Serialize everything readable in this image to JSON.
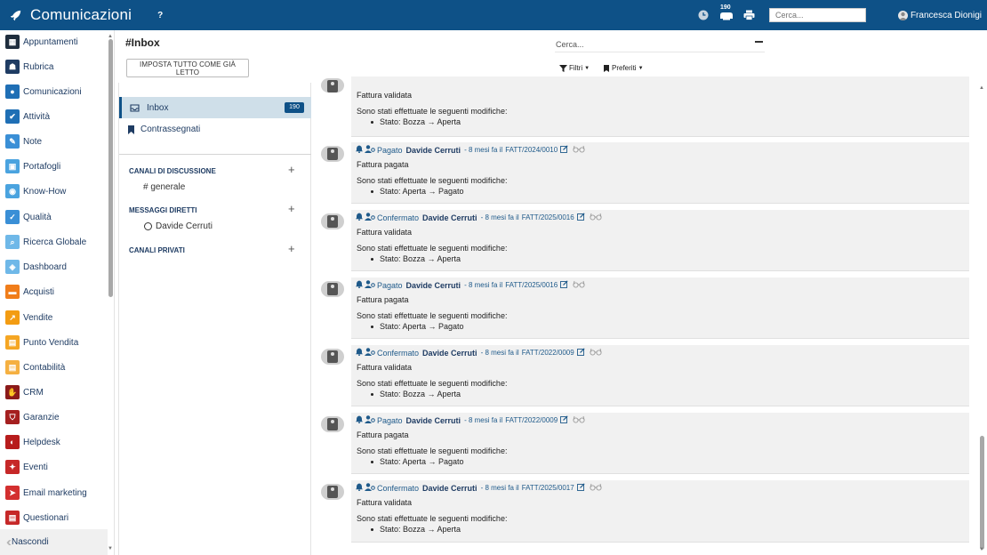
{
  "topbar": {
    "title": "Comunicazioni",
    "help": "?",
    "notif_count": "190",
    "search_placeholder": "Cerca...",
    "user_name": "Francesca Dionigi"
  },
  "sidebar": {
    "items": [
      {
        "label": "Appuntamenti",
        "icon": "calendar-icon",
        "color": "#1f2d3d"
      },
      {
        "label": "Rubrica",
        "icon": "contacts-icon",
        "color": "#1f3c63"
      },
      {
        "label": "Comunicazioni",
        "icon": "chat-icon",
        "color": "#1f6fb5"
      },
      {
        "label": "Attività",
        "icon": "check-icon",
        "color": "#1f6fb5"
      },
      {
        "label": "Note",
        "icon": "note-icon",
        "color": "#3a8fd6"
      },
      {
        "label": "Portafogli",
        "icon": "lock-icon",
        "color": "#4aa3df"
      },
      {
        "label": "Know-How",
        "icon": "brain-icon",
        "color": "#4aa3df"
      },
      {
        "label": "Qualità",
        "icon": "quality-icon",
        "color": "#3a8fd6"
      },
      {
        "label": "Ricerca Globale",
        "icon": "search-icon",
        "color": "#6fb8e8"
      },
      {
        "label": "Dashboard",
        "icon": "dashboard-icon",
        "color": "#6fb8e8"
      },
      {
        "label": "Acquisti",
        "icon": "purchase-icon",
        "color": "#f07d1a"
      },
      {
        "label": "Vendite",
        "icon": "sales-icon",
        "color": "#f39c12"
      },
      {
        "label": "Punto Vendita",
        "icon": "pos-icon",
        "color": "#f5a623"
      },
      {
        "label": "Contabilità",
        "icon": "accounting-icon",
        "color": "#f5b041"
      },
      {
        "label": "CRM",
        "icon": "handshake-icon",
        "color": "#8b1a1a"
      },
      {
        "label": "Garanzie",
        "icon": "shield-icon",
        "color": "#a52020"
      },
      {
        "label": "Helpdesk",
        "icon": "headset-icon",
        "color": "#b71c1c"
      },
      {
        "label": "Eventi",
        "icon": "ticket-icon",
        "color": "#c62828"
      },
      {
        "label": "Email marketing",
        "icon": "send-icon",
        "color": "#d32f2f"
      },
      {
        "label": "Questionari",
        "icon": "survey-icon",
        "color": "#c62828"
      }
    ],
    "hide_label": "Nascondi"
  },
  "channel": {
    "title": "#Inbox",
    "mark_all_read": "IMPOSTA TUTTO COME GIÀ LETTO",
    "inbox_label": "Inbox",
    "inbox_count": "190",
    "starred_label": "Contrassegnati",
    "sections": [
      {
        "title": "CANALI DI DISCUSSIONE",
        "items": [
          "# generale"
        ]
      },
      {
        "title": "MESSAGGI DIRETTI",
        "items": [
          "Davide Cerruti"
        ]
      },
      {
        "title": "CANALI PRIVATI",
        "items": []
      }
    ]
  },
  "feed_controls": {
    "search_placeholder": "Cerca...",
    "filters_label": "Filtri",
    "favorites_label": "Preferiti"
  },
  "messages": [
    {
      "state": "",
      "author": "",
      "time": "",
      "doc": "",
      "summary": "Fattura validata",
      "changes_intro": "Sono stati effettuate le seguenti modifiche:",
      "change": "Stato: Bozza → Aperta"
    },
    {
      "state": "Pagato",
      "author": "Davide Cerruti",
      "time": "- 8 mesi fa il",
      "doc": "FATT/2024/0010",
      "summary": "Fattura pagata",
      "changes_intro": "Sono stati effettuate le seguenti modifiche:",
      "change": "Stato: Aperta → Pagato"
    },
    {
      "state": "Confermato",
      "author": "Davide Cerruti",
      "time": "- 8 mesi fa il",
      "doc": "FATT/2025/0016",
      "summary": "Fattura validata",
      "changes_intro": "Sono stati effettuate le seguenti modifiche:",
      "change": "Stato: Bozza → Aperta"
    },
    {
      "state": "Pagato",
      "author": "Davide Cerruti",
      "time": "- 8 mesi fa il",
      "doc": "FATT/2025/0016",
      "summary": "Fattura pagata",
      "changes_intro": "Sono stati effettuate le seguenti modifiche:",
      "change": "Stato: Aperta → Pagato"
    },
    {
      "state": "Confermato",
      "author": "Davide Cerruti",
      "time": "- 8 mesi fa il",
      "doc": "FATT/2022/0009",
      "summary": "Fattura validata",
      "changes_intro": "Sono stati effettuate le seguenti modifiche:",
      "change": "Stato: Bozza → Aperta"
    },
    {
      "state": "Pagato",
      "author": "Davide Cerruti",
      "time": "- 8 mesi fa il",
      "doc": "FATT/2022/0009",
      "summary": "Fattura pagata",
      "changes_intro": "Sono stati effettuate le seguenti modifiche:",
      "change": "Stato: Aperta → Pagato"
    },
    {
      "state": "Confermato",
      "author": "Davide Cerruti",
      "time": "- 8 mesi fa il",
      "doc": "FATT/2025/0017",
      "summary": "Fattura validata",
      "changes_intro": "Sono stati effettuate le seguenti modifiche:",
      "change": "Stato: Bozza → Aperta"
    }
  ]
}
